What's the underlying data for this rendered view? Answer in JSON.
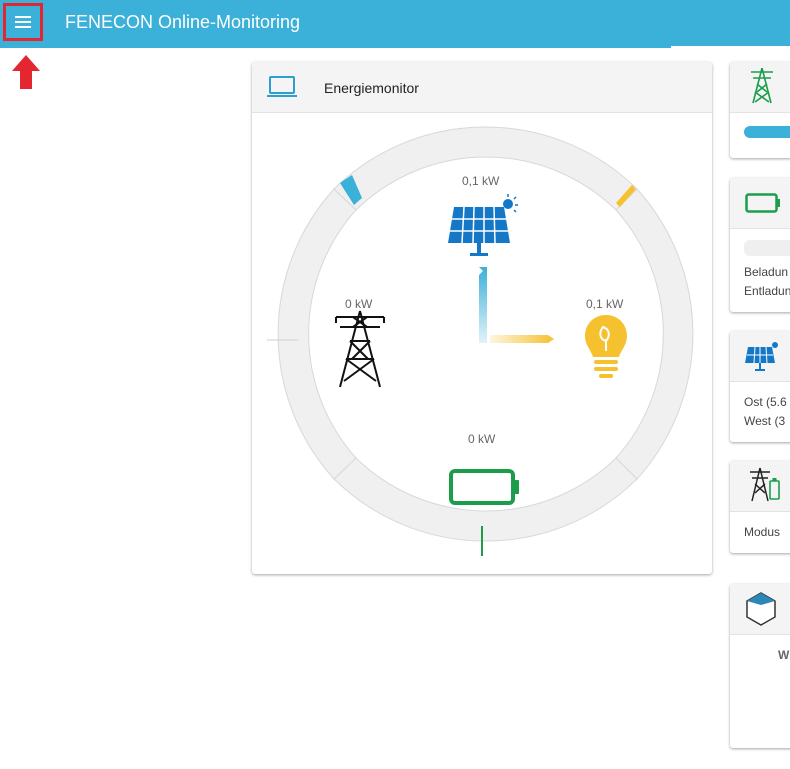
{
  "app": {
    "title": "FENECON Online-Monitoring"
  },
  "energy_monitor": {
    "title": "Energiemonitor",
    "production_value": "0,1 kW",
    "grid_value": "0 kW",
    "consumption_value": "0,1 kW",
    "storage_value": "0 kW"
  },
  "side_cards": {
    "storage": {
      "line1": "Beladun",
      "line2": "Entladun"
    },
    "production": {
      "line1": "Ost (5.6",
      "line2": "West (3"
    },
    "gridmode": {
      "line1": "Modus"
    },
    "widget": {
      "line1": "W"
    }
  },
  "colors": {
    "accent": "#3bb0d8",
    "production": "#3bb0d8",
    "consumption": "#f5c12e",
    "storage": "#1b9d4c",
    "highlight": "#e3262f"
  },
  "icons": {
    "menu": "menu-icon",
    "pointer": "red-arrow-icon",
    "energy_monitor": "laptop-icon",
    "production": "solar-panel-icon",
    "grid": "power-tower-icon",
    "consumption": "lightbulb-icon",
    "storage": "battery-icon"
  }
}
